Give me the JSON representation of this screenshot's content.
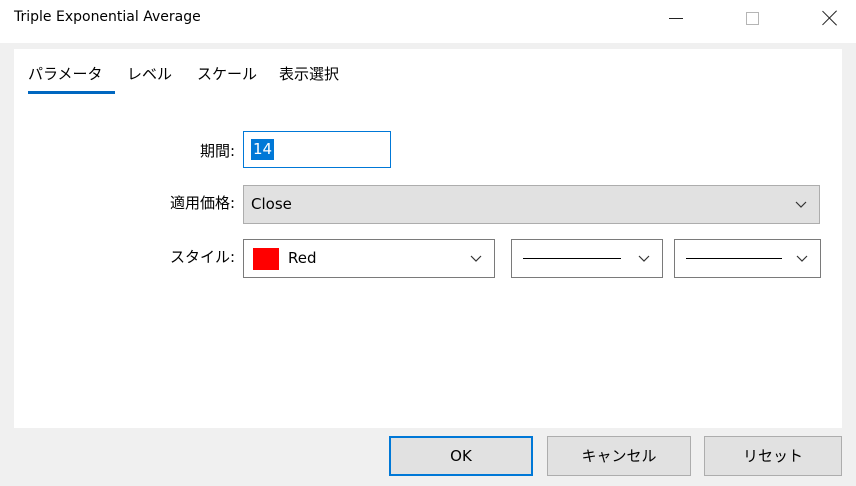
{
  "window": {
    "title": "Triple Exponential Average",
    "controls": {
      "minimize_icon": "minimize-icon",
      "maximize_icon": "maximize-icon",
      "close_icon": "close-icon"
    }
  },
  "tabs": [
    {
      "label": "パラメータ",
      "active": true
    },
    {
      "label": "レベル",
      "active": false
    },
    {
      "label": "スケール",
      "active": false
    },
    {
      "label": "表示選択",
      "active": false
    }
  ],
  "params": {
    "period": {
      "label": "期間:",
      "value": "14"
    },
    "apply_to": {
      "label": "適用価格:",
      "value": "Close"
    },
    "style": {
      "label": "スタイル:",
      "color_name": "Red",
      "color_hex": "#ff0000",
      "line_style": "solid",
      "line_width": "thin"
    }
  },
  "buttons": {
    "ok": "OK",
    "cancel": "キャンセル",
    "reset": "リセット"
  },
  "colors": {
    "accent": "#0078d7",
    "tab_underline": "#0067c0",
    "swatch": "#ff0000"
  }
}
